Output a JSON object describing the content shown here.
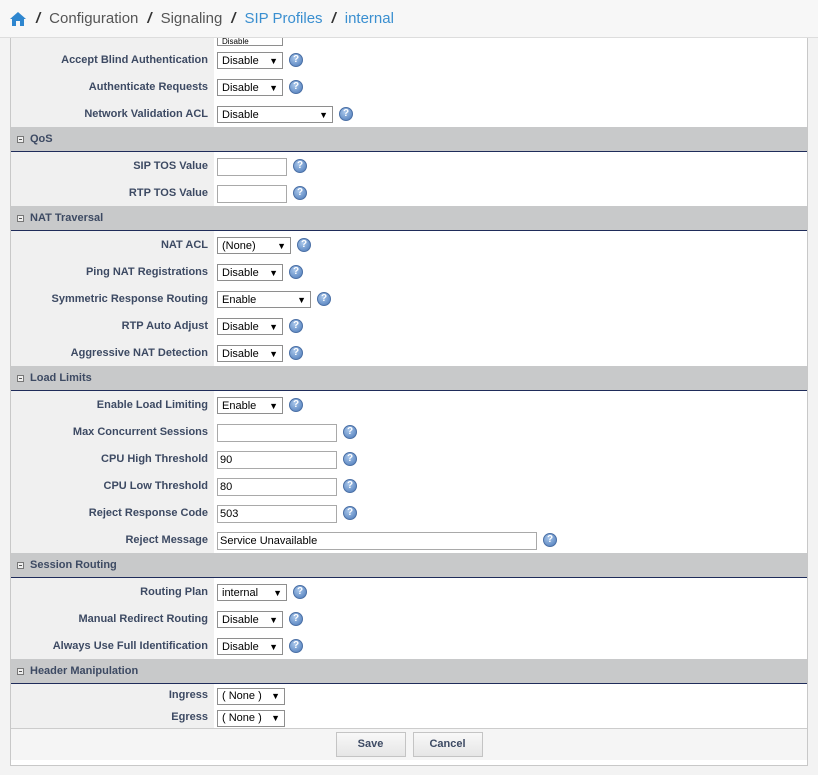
{
  "breadcrumb": {
    "home_icon": "home-icon",
    "items": [
      {
        "label": "Configuration",
        "link": false
      },
      {
        "label": "Signaling",
        "link": false
      },
      {
        "label": "SIP Profiles",
        "link": true
      },
      {
        "label": "internal",
        "link": true
      }
    ]
  },
  "colors": {
    "link": "#3a8fd0",
    "section_bg": "#c8c9ca",
    "label_text": "#3d4a63"
  },
  "top_rows": [
    {
      "label": "Accept Blind Authentication",
      "type": "select",
      "value": "Disable",
      "w": 66
    },
    {
      "label": "Authenticate Requests",
      "type": "select",
      "value": "Disable",
      "w": 66
    },
    {
      "label": "Network Validation ACL",
      "type": "select",
      "value": "Disable",
      "w": 116
    }
  ],
  "partial_value": "Disable",
  "sections": [
    {
      "title": "QoS",
      "rows": [
        {
          "label": "SIP TOS Value",
          "type": "input",
          "value": "",
          "w": 70
        },
        {
          "label": "RTP TOS Value",
          "type": "input",
          "value": "",
          "w": 70
        }
      ]
    },
    {
      "title": "NAT Traversal",
      "rows": [
        {
          "label": "NAT ACL",
          "type": "select",
          "value": "(None)",
          "w": 74
        },
        {
          "label": "Ping NAT Registrations",
          "type": "select",
          "value": "Disable",
          "w": 66
        },
        {
          "label": "Symmetric Response Routing",
          "type": "select",
          "value": "Enable",
          "w": 94
        },
        {
          "label": "RTP Auto Adjust",
          "type": "select",
          "value": "Disable",
          "w": 66
        },
        {
          "label": "Aggressive NAT Detection",
          "type": "select",
          "value": "Disable",
          "w": 66
        }
      ]
    },
    {
      "title": "Load Limits",
      "rows": [
        {
          "label": "Enable Load Limiting",
          "type": "select",
          "value": "Enable",
          "w": 66
        },
        {
          "label": "Max Concurrent Sessions",
          "type": "input",
          "value": "",
          "w": 120
        },
        {
          "label": "CPU High Threshold",
          "type": "input",
          "value": "90",
          "w": 120
        },
        {
          "label": "CPU Low Threshold",
          "type": "input",
          "value": "80",
          "w": 120
        },
        {
          "label": "Reject Response Code",
          "type": "input",
          "value": "503",
          "w": 120
        },
        {
          "label": "Reject Message",
          "type": "input",
          "value": "Service Unavailable",
          "w": 320
        }
      ]
    },
    {
      "title": "Session Routing",
      "rows": [
        {
          "label": "Routing Plan",
          "type": "select",
          "value": "internal",
          "w": 70
        },
        {
          "label": "Manual Redirect Routing",
          "type": "select",
          "value": "Disable",
          "w": 66
        },
        {
          "label": "Always Use Full Identification",
          "type": "select",
          "value": "Disable",
          "w": 66
        }
      ]
    },
    {
      "title": "Header Manipulation",
      "short": true,
      "nohelp": true,
      "rows": [
        {
          "label": "Ingress",
          "type": "select",
          "value": "( None )",
          "w": 68
        },
        {
          "label": "Egress",
          "type": "select",
          "value": "( None )",
          "w": 68
        }
      ]
    }
  ],
  "buttons": {
    "save": "Save",
    "cancel": "Cancel"
  }
}
